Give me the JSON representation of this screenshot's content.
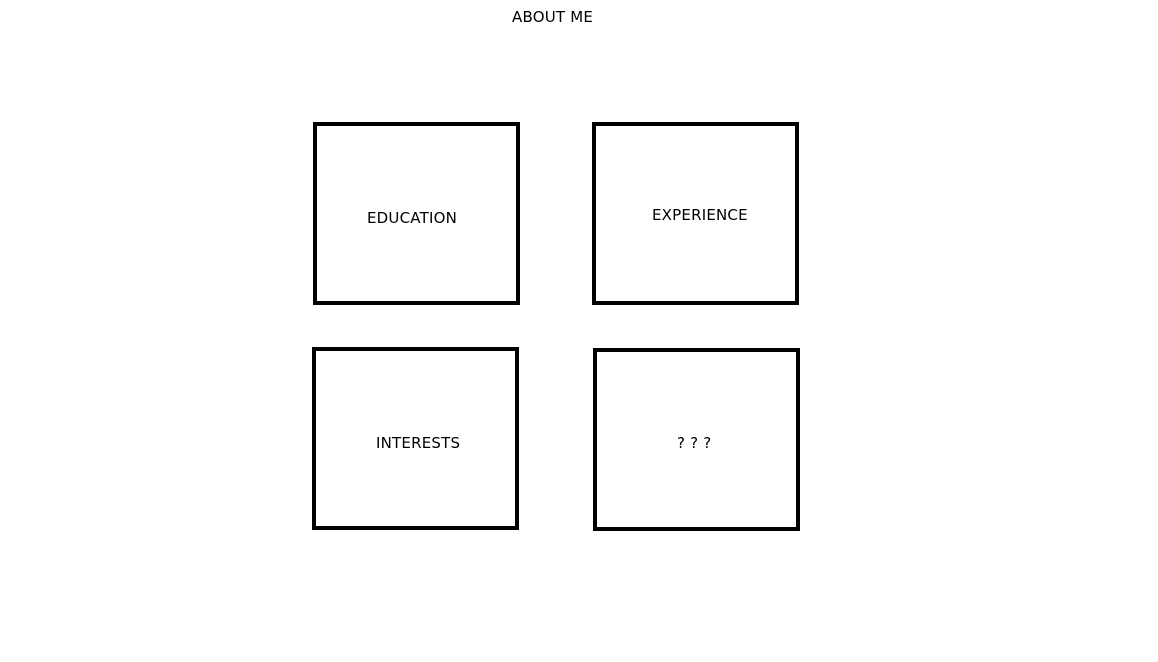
{
  "page": {
    "title": "ABOUT ME"
  },
  "tiles": [
    {
      "label": "EDUCATION"
    },
    {
      "label": "EXPERIENCE"
    },
    {
      "label": "INTERESTS"
    },
    {
      "label": "? ? ?"
    }
  ],
  "colors": {
    "background": "#ffffff",
    "border": "#000000",
    "text": "#000000"
  }
}
